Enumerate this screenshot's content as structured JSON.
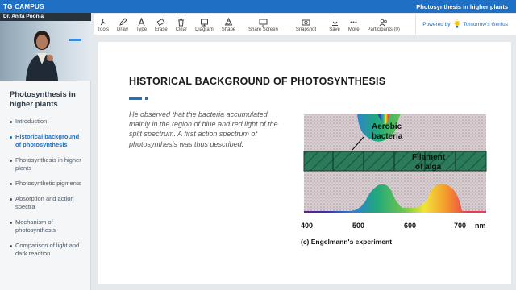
{
  "app": {
    "brand": "TG CAMPUS",
    "session_title": "Photosynthesis in higher plants"
  },
  "presenter": {
    "name": "Dr. Anita Poonia"
  },
  "sidebar": {
    "title": "Photosynthesis in higher plants",
    "items": [
      {
        "label": "Introduction",
        "active": false
      },
      {
        "label": "Historical background of photosynthesis",
        "active": true
      },
      {
        "label": "Photosynthesis in higher plants",
        "active": false
      },
      {
        "label": "Photosynthetic pigments",
        "active": false
      },
      {
        "label": "Absorption and action spectra",
        "active": false
      },
      {
        "label": "Mechanism of photosynthesis",
        "active": false
      },
      {
        "label": "Comparison of light and dark reaction",
        "active": false
      }
    ]
  },
  "toolbar": {
    "tools": [
      {
        "label": "Tools",
        "icon": "tools-icon"
      },
      {
        "label": "Draw",
        "icon": "pencil-icon"
      },
      {
        "label": "Type",
        "icon": "text-icon"
      },
      {
        "label": "Erase",
        "icon": "eraser-icon"
      },
      {
        "label": "Clear",
        "icon": "trash-icon"
      },
      {
        "label": "Diagram",
        "icon": "diagram-icon"
      },
      {
        "label": "Shape",
        "icon": "shape-icon"
      },
      {
        "label": "Share Screen",
        "icon": "share-screen-icon"
      },
      {
        "label": "Snapshot",
        "icon": "camera-icon"
      },
      {
        "label": "Save",
        "icon": "save-icon"
      },
      {
        "label": "More",
        "icon": "more-icon"
      },
      {
        "label": "Participants (0)",
        "icon": "participants-icon"
      }
    ],
    "powered_by": "Powered by",
    "partner": "Tomorrow's Genius"
  },
  "slide": {
    "title": "HISTORICAL BACKGROUND OF PHOTOSYNTHESIS",
    "body": "He observed that the bacteria accumulated mainly in the region of blue and red light of the split spectrum. A first action spectrum of photosynthesis was thus described.",
    "figure": {
      "label_bacteria_1": "Aerobic",
      "label_bacteria_2": "bacteria",
      "label_alga_1": "Filament",
      "label_alga_2": "of alga",
      "axis_ticks": [
        "400",
        "500",
        "600",
        "700"
      ],
      "axis_unit": "nm",
      "caption": "(c) Engelmann's experiment"
    }
  },
  "colors": {
    "accent": "#1f6fc4",
    "alga": "#2b7a5a",
    "bacteria": "#d9cfd2"
  }
}
